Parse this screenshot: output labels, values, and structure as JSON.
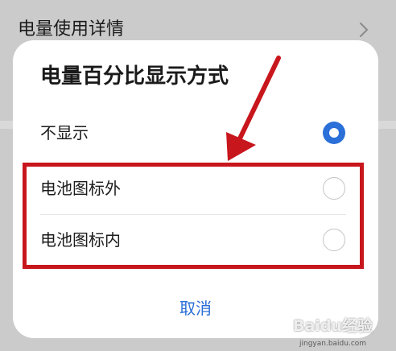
{
  "background": {
    "row_title": "电量使用详情"
  },
  "dialog": {
    "title": "电量百分比显示方式",
    "options": [
      {
        "label": "不显示",
        "selected": true
      },
      {
        "label": "电池图标外",
        "selected": false
      },
      {
        "label": "电池图标内",
        "selected": false
      }
    ],
    "cancel_label": "取消"
  },
  "watermark": {
    "logo_text": "Baidu经验",
    "url_text": "jingyan.baidu.com"
  },
  "colors": {
    "accent": "#2b6fd8",
    "annotation": "#c8161d",
    "overlay": "#cbcbcb"
  },
  "icons": {
    "background_row": "chevron-right-icon",
    "option_selected": "radio-selected-icon",
    "option_unselected": "radio-unselected-icon",
    "annotation": "red-arrow-icon"
  }
}
